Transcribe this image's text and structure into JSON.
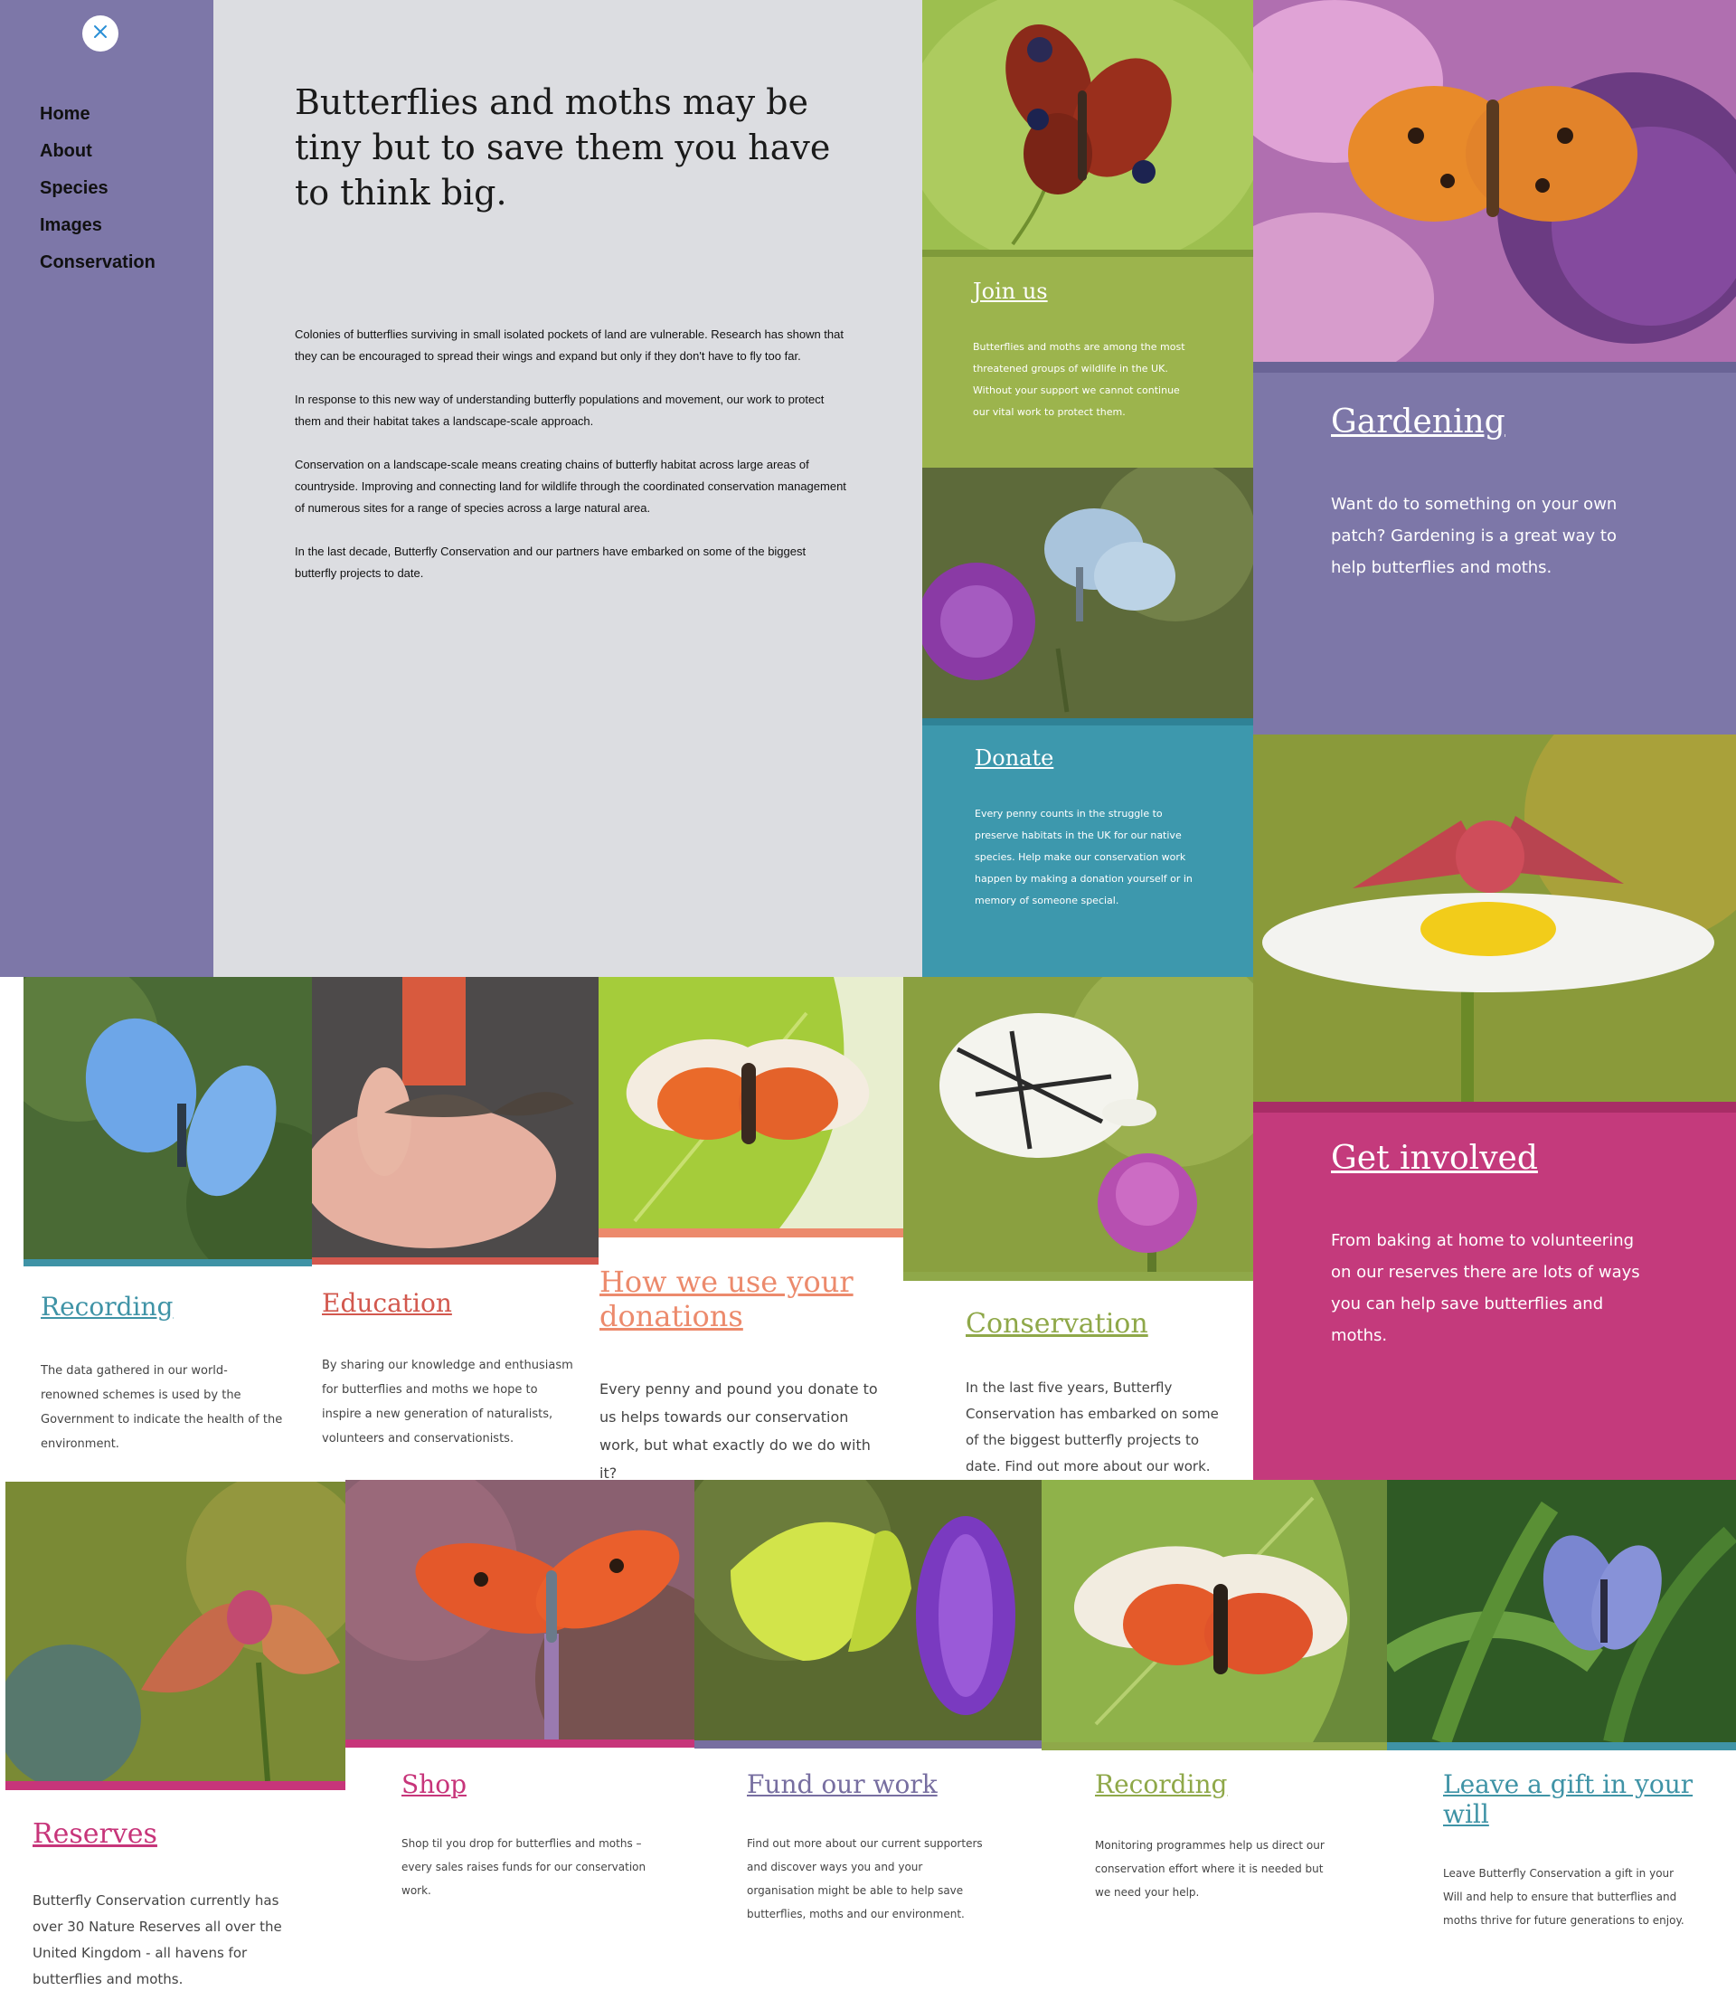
{
  "sidebar": {
    "close_icon": "close-icon",
    "nav": [
      "Home",
      "About",
      "Species",
      "Images",
      "Conservation"
    ]
  },
  "intro": {
    "heading": "Butterflies and moths may be tiny but to save them you have to think big.",
    "paragraphs": [
      "Colonies of butterflies surviving in small isolated pockets of land are vulnerable. Research has shown that they can be encouraged to spread their wings and expand but only if they don't have to fly too far.",
      "In response to this new way of understanding butterfly populations and movement, our work to protect them and their habitat takes a landscape-scale approach.",
      "Conservation on a landscape-scale means creating chains of butterfly habitat across large areas of countryside. Improving and connecting land for wildlife through the coordinated conservation management of numerous sites for a range of species across a large natural area.",
      "In the last decade, Butterfly Conservation and our partners have embarked on some of the biggest butterfly projects to date."
    ]
  },
  "cards": {
    "join": {
      "title": "Join us",
      "text": "Butterflies and moths are among the most threatened groups of wildlife in the UK. Without your support we cannot continue our vital work to protect them."
    },
    "donate": {
      "title": "Donate",
      "text": "Every penny counts in the struggle to preserve habitats in the UK for our native species. Help make our conservation work happen by making a donation yourself or in memory of someone special."
    },
    "gardening": {
      "title": "Gardening",
      "text": "Want do to something on your own patch? Gardening is a great way to help butterflies and moths."
    },
    "get_involved": {
      "title": "Get involved",
      "text": "From baking at home to volunteering on our reserves there are lots of ways you can help save butterflies and moths."
    },
    "recording1": {
      "title": "Recording",
      "text": "The data gathered in our world-renowned schemes  is used by the Government to indicate the health of the environment."
    },
    "education": {
      "title": "Education",
      "text": "By sharing our knowledge and enthusiasm for butterflies and moths we hope to inspire a new generation of naturalists, volunteers and conservationists."
    },
    "donations": {
      "title": "How we use your donations",
      "text": "Every penny and pound you donate to us helps towards our conservation work, but what exactly do we do with it?"
    },
    "conservation": {
      "title": "Conservation",
      "text": "In the last five years, Butterfly Conservation has embarked on some of the biggest butterfly projects to date. Find out more about our work."
    },
    "reserves": {
      "title": "Reserves",
      "text": "Butterfly Conservation currently has over 30 Nature Reserves all over the United Kingdom - all havens for butterflies and moths."
    },
    "shop": {
      "title": "Shop",
      "text": "Shop til you drop for butterflies and moths – every sales raises funds for our conservation work."
    },
    "fund": {
      "title": "Fund our work",
      "text": "Find out more about our current supporters and discover ways you and your organisation might be able to help save butterflies, moths and our environment."
    },
    "recording2": {
      "title": "Recording",
      "text": "Monitoring programmes help us direct our conservation effort where it is needed but we need your help."
    },
    "gift": {
      "title": "Leave a gift in your will",
      "text": "Leave Butterfly Conservation a gift in your Will and help to ensure that butterflies and moths thrive for future generations to enjoy."
    }
  },
  "colors": {
    "sidebar": "#7d77a8",
    "intro_bg": "#dcdde1",
    "join_green": "#9cb44d",
    "donate_teal": "#3d98ad",
    "gardening_purple": "#7d77a8",
    "get_involved_pink": "#c43a7c",
    "recording_teal": "#3f93a6",
    "education_red": "#d2584e",
    "donations_orange": "#ec8a6c",
    "conservation_green": "#8fa849",
    "reserves_pink": "#c7357a",
    "fund_purple": "#776ea0"
  }
}
